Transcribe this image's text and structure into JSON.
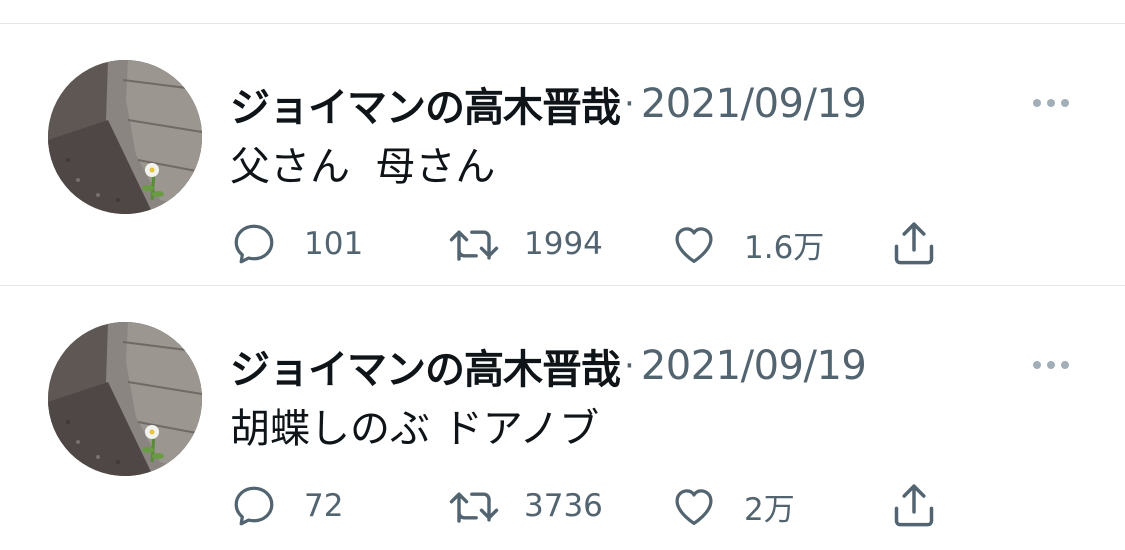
{
  "colors": {
    "text_primary": "#0f1419",
    "text_secondary": "#536471",
    "icon": "#536471",
    "divider": "#e3e7ea"
  },
  "tweets": [
    {
      "author": "ジョイマンの高木晋哉",
      "separator": "·",
      "date": "2021/09/19",
      "text": "父さん  母さん",
      "replies": "101",
      "retweets": "1994",
      "likes": "1.6万"
    },
    {
      "author": "ジョイマンの高木晋哉",
      "separator": "·",
      "date": "2021/09/19",
      "text": "胡蝶しのぶ ドアノブ",
      "replies": "72",
      "retweets": "3736",
      "likes": "2万"
    }
  ],
  "icons": {
    "reply": "reply-icon",
    "retweet": "retweet-icon",
    "like": "heart-icon",
    "share": "share-icon",
    "more": "more-icon"
  }
}
